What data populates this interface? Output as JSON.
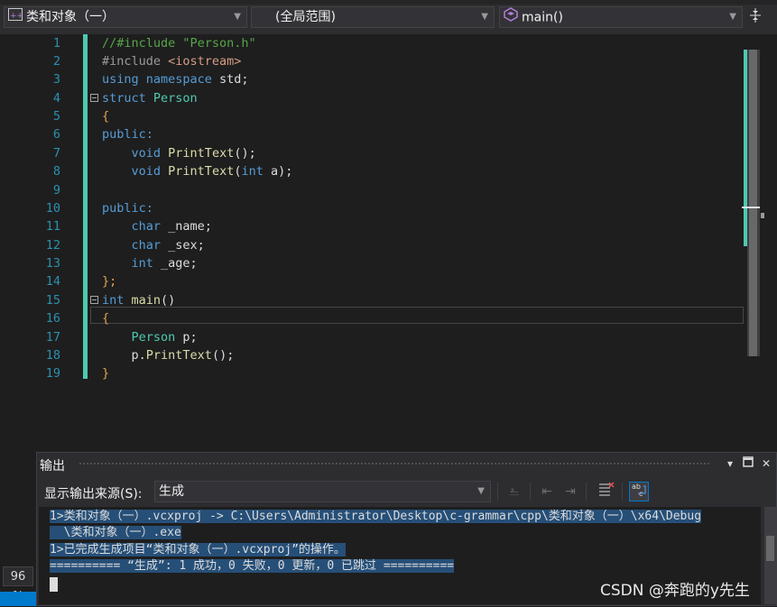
{
  "navbar": {
    "project": "类和对象（一）",
    "scope": "(全局范围)",
    "member": "main()"
  },
  "editor": {
    "lines": [
      {
        "n": "1",
        "text": "//#include \"Person.h\""
      },
      {
        "n": "2",
        "text": "#include <iostream>"
      },
      {
        "n": "3",
        "text": "using namespace std;"
      },
      {
        "n": "4",
        "text": "struct Person"
      },
      {
        "n": "5",
        "text": "{"
      },
      {
        "n": "6",
        "text": "public:"
      },
      {
        "n": "7",
        "text": "    void PrintText();"
      },
      {
        "n": "8",
        "text": "    void PrintText(int a);"
      },
      {
        "n": "9",
        "text": ""
      },
      {
        "n": "10",
        "text": "public:"
      },
      {
        "n": "11",
        "text": "    char _name;"
      },
      {
        "n": "12",
        "text": "    char _sex;"
      },
      {
        "n": "13",
        "text": "    int _age;"
      },
      {
        "n": "14",
        "text": "};"
      },
      {
        "n": "15",
        "text": "int main()"
      },
      {
        "n": "16",
        "text": "{"
      },
      {
        "n": "17",
        "text": "    Person p;"
      },
      {
        "n": "18",
        "text": "    p.PrintText();"
      },
      {
        "n": "19",
        "text": "}"
      }
    ],
    "zoom": "96 %"
  },
  "output": {
    "title": "输出",
    "source_label": "显示输出来源(S):",
    "source_value": "生成",
    "lines": [
      "1>类和对象（一）.vcxproj -> C:\\Users\\Administrator\\Desktop\\c-grammar\\cpp\\类和对象（一）\\x64\\Debug",
      "  \\类和对象（一）.exe",
      "1>已完成生成项目“类和对象（一）.vcxproj”的操作。",
      "========== “生成”: 1 成功，0 失败，0 更新，0 已跳过 =========="
    ]
  },
  "watermark": "CSDN @奔跑的y先生",
  "colors": {
    "keyword": "#569cd6",
    "type": "#4ec9b0",
    "comment": "#57a64a",
    "string": "#d69d85",
    "line_number": "#2b91af",
    "change_bar": "#4ec9b0",
    "selection": "#264f78"
  }
}
